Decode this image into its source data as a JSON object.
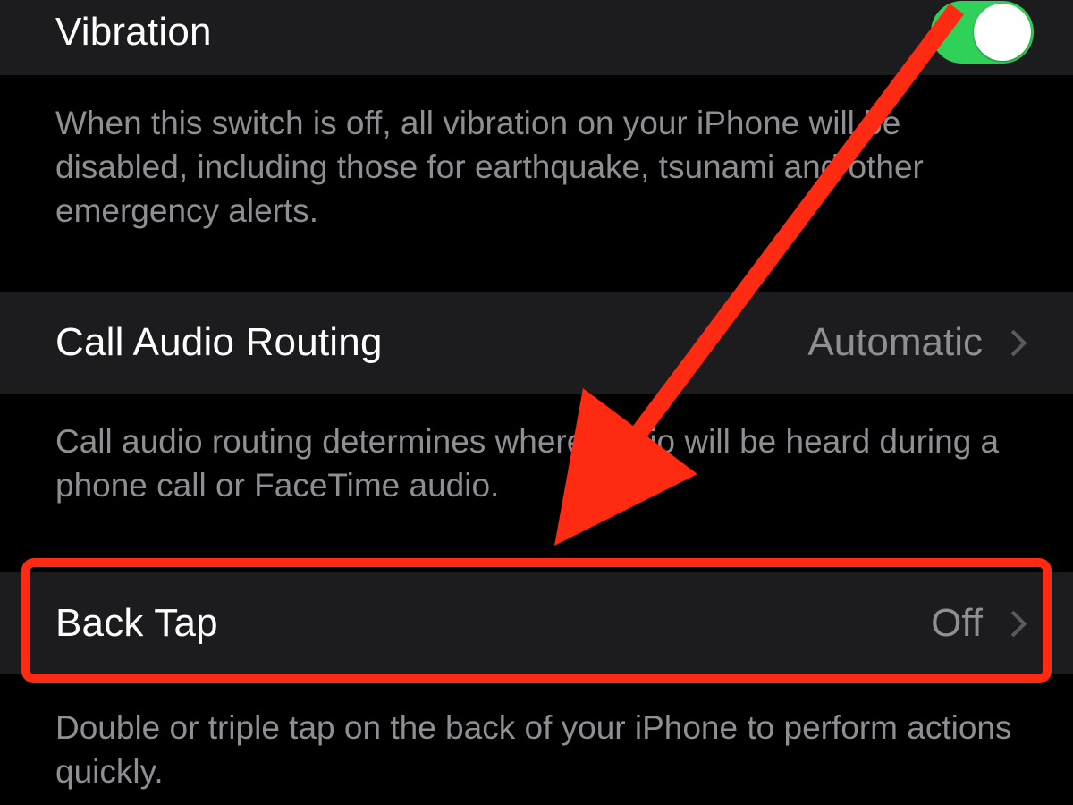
{
  "sections": {
    "vibration": {
      "label": "Vibration",
      "toggle_on": true,
      "description": "When this switch is off, all vibration on your iPhone will be disabled, including those for earthquake, tsunami and other emergency alerts."
    },
    "call_audio_routing": {
      "label": "Call Audio Routing",
      "value": "Automatic",
      "description": "Call audio routing determines where audio will be heard during a phone call or FaceTime audio."
    },
    "back_tap": {
      "label": "Back Tap",
      "value": "Off",
      "description": "Double or triple tap on the back of your iPhone to perform actions quickly."
    }
  },
  "annotation": {
    "highlight_target": "back-tap-row",
    "arrow_color": "#ff2a12"
  }
}
